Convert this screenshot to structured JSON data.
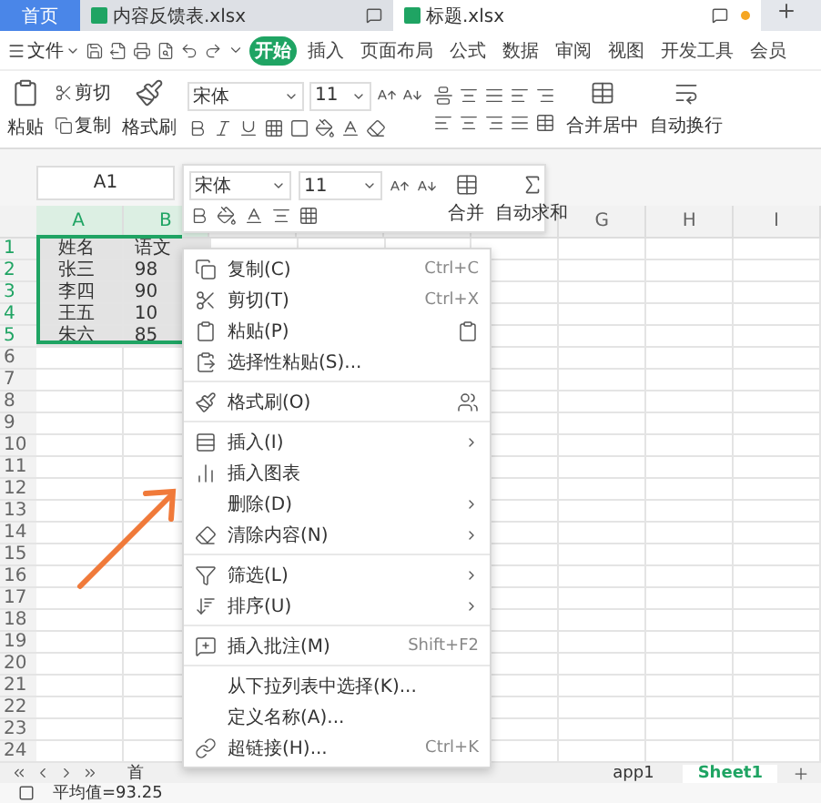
{
  "doc_tabs": [
    {
      "label": "首页",
      "kind": "home",
      "selected": false
    },
    {
      "label": "内容反馈表.xlsx",
      "kind": "file",
      "selected": false
    },
    {
      "label": "标题.xlsx",
      "kind": "file",
      "selected": true,
      "unsaved": true
    }
  ],
  "menu": {
    "file": "文件",
    "tabs": [
      {
        "label": "开始",
        "selected": true
      },
      {
        "label": "插入",
        "selected": false
      },
      {
        "label": "页面布局",
        "selected": false
      },
      {
        "label": "公式",
        "selected": false
      },
      {
        "label": "数据",
        "selected": false
      },
      {
        "label": "审阅",
        "selected": false
      },
      {
        "label": "视图",
        "selected": false
      },
      {
        "label": "开发工具",
        "selected": false
      },
      {
        "label": "会员",
        "selected": false
      }
    ]
  },
  "ribbon": {
    "paste": "粘贴",
    "cut": "剪切",
    "copy": "复制",
    "format_painter": "格式刷",
    "font": "宋体",
    "size": "11",
    "merge": "合并居中",
    "wrap": "自动换行"
  },
  "name_box": "A1",
  "mini_toolbar": {
    "font": "宋体",
    "size": "11",
    "merge": "合并",
    "autosum": "自动求和"
  },
  "columns_left": [
    "A",
    "B"
  ],
  "columns_right": [
    "G",
    "H",
    "I"
  ],
  "rows": [
    {
      "number": "1",
      "selected": true,
      "cells": [
        "姓名",
        "语文"
      ]
    },
    {
      "number": "2",
      "selected": true,
      "cells": [
        "张三",
        "98"
      ]
    },
    {
      "number": "3",
      "selected": true,
      "cells": [
        "李四",
        "90"
      ]
    },
    {
      "number": "4",
      "selected": true,
      "cells": [
        "王五",
        "10"
      ]
    },
    {
      "number": "5",
      "selected": true,
      "cells": [
        "朱六",
        "85"
      ]
    },
    {
      "number": "6",
      "selected": false
    },
    {
      "number": "7",
      "selected": false
    },
    {
      "number": "8",
      "selected": false
    },
    {
      "number": "9",
      "selected": false
    },
    {
      "number": "10",
      "selected": false
    },
    {
      "number": "11",
      "selected": false
    },
    {
      "number": "12",
      "selected": false
    },
    {
      "number": "13",
      "selected": false
    },
    {
      "number": "14",
      "selected": false
    },
    {
      "number": "15",
      "selected": false
    },
    {
      "number": "16",
      "selected": false
    },
    {
      "number": "17",
      "selected": false
    },
    {
      "number": "18",
      "selected": false
    },
    {
      "number": "19",
      "selected": false
    },
    {
      "number": "20",
      "selected": false
    },
    {
      "number": "21",
      "selected": false
    },
    {
      "number": "22",
      "selected": false
    },
    {
      "number": "23",
      "selected": false
    },
    {
      "number": "24",
      "selected": false
    }
  ],
  "context_menu": [
    {
      "kind": "item",
      "label": "复制(C)",
      "shortcut": "Ctrl+C"
    },
    {
      "kind": "item",
      "label": "剪切(T)",
      "shortcut": "Ctrl+X"
    },
    {
      "kind": "item",
      "label": "粘贴(P)",
      "side_button": true
    },
    {
      "kind": "item",
      "label": "选择性粘贴(S)..."
    },
    {
      "kind": "divider"
    },
    {
      "kind": "item",
      "label": "格式刷(O)",
      "side_button": true
    },
    {
      "kind": "divider"
    },
    {
      "kind": "item",
      "label": "插入(I)",
      "submenu": true
    },
    {
      "kind": "item",
      "label": "插入图表"
    },
    {
      "kind": "item",
      "label": "删除(D)",
      "submenu": true
    },
    {
      "kind": "item",
      "label": "清除内容(N)",
      "submenu": true
    },
    {
      "kind": "divider"
    },
    {
      "kind": "item",
      "label": "筛选(L)",
      "submenu": true
    },
    {
      "kind": "item",
      "label": "排序(U)",
      "submenu": true
    },
    {
      "kind": "divider"
    },
    {
      "kind": "item",
      "label": "插入批注(M)",
      "shortcut": "Shift+F2"
    },
    {
      "kind": "divider"
    },
    {
      "kind": "item",
      "label": "从下拉列表中选择(K)..."
    },
    {
      "kind": "item",
      "label": "定义名称(A)..."
    },
    {
      "kind": "item",
      "label": "超链接(H)...",
      "shortcut": "Ctrl+K"
    }
  ],
  "sheet_tabs": [
    {
      "label": "首",
      "selected": false
    },
    {
      "label": "app1",
      "selected": false
    },
    {
      "label": "Sheet1",
      "selected": true
    }
  ],
  "status_bar": "平均值=93.25"
}
